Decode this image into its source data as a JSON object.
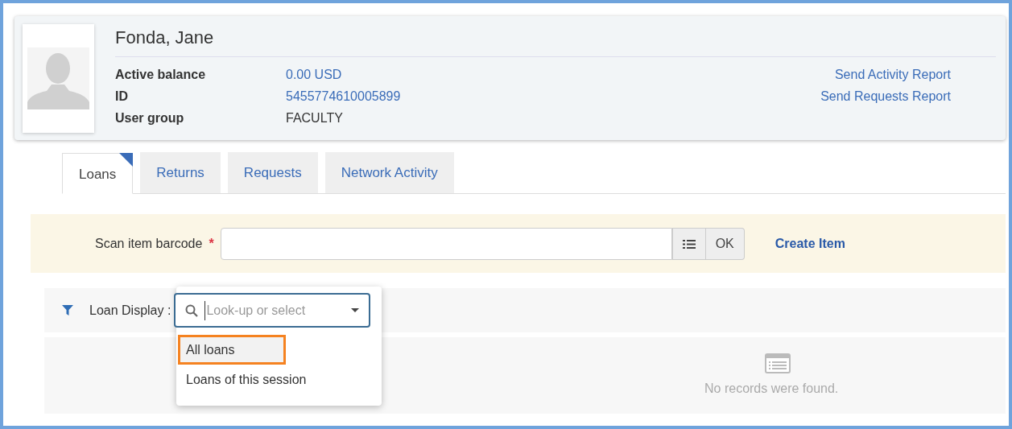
{
  "patron": {
    "name": "Fonda, Jane",
    "fields": [
      {
        "label": "Active balance",
        "value": "0.00 USD",
        "kind": "link"
      },
      {
        "label": "ID",
        "value": "5455774610005899",
        "kind": "link"
      },
      {
        "label": "User group",
        "value": "FACULTY",
        "kind": "text"
      }
    ],
    "actions": [
      "Send Activity Report",
      "Send Requests Report"
    ]
  },
  "tabs": [
    {
      "label": "Loans",
      "selected": true
    },
    {
      "label": "Returns",
      "selected": false
    },
    {
      "label": "Requests",
      "selected": false
    },
    {
      "label": "Network Activity",
      "selected": false
    }
  ],
  "scan": {
    "label": "Scan item barcode",
    "required_mark": "*",
    "ok_button": "OK",
    "create_link": "Create Item"
  },
  "filter": {
    "label": "Loan Display :",
    "placeholder": "Look-up or select",
    "options": [
      {
        "label": "All loans",
        "highlighted": true,
        "annotated": true
      },
      {
        "label": "Loans of this session",
        "highlighted": false,
        "annotated": false
      }
    ]
  },
  "empty_message": "No records were found."
}
